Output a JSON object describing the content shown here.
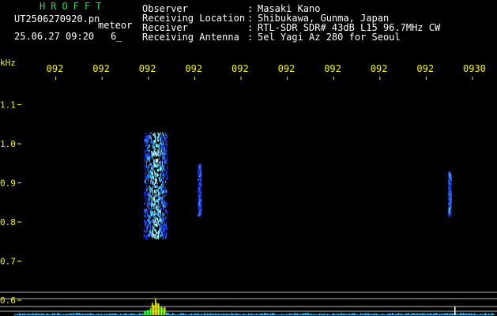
{
  "header": {
    "title": "HROFFT",
    "filename": "UT2506270920.pn",
    "tag": "meteor",
    "datetime": "25.06.27 09:20",
    "count": "6_"
  },
  "info": [
    {
      "label": "Observer",
      "value": "Masaki Kano"
    },
    {
      "label": "Receiving Location",
      "value": "Shibukawa, Gunma, Japan"
    },
    {
      "label": "Receiver",
      "value": "RTL-SDR SDR# 43dB L15 96.7MHz CW"
    },
    {
      "label": "Receiving Antenna",
      "value": "5el Yagi Az 280 for Seoul"
    }
  ],
  "colors": {
    "title": "#22e04a",
    "text": "#ffffff",
    "axis": "#f4f400",
    "background": "#000000"
  },
  "chart_data": {
    "type": "heatmap",
    "ylabel": "kHz",
    "yticks": [
      "1.1",
      "1.0",
      "0.9",
      "0.8",
      "0.7",
      "0.6"
    ],
    "ytick_values": [
      1.1,
      1.0,
      0.9,
      0.8,
      0.7,
      0.6
    ],
    "xticks": [
      "092",
      "092",
      "092",
      "092",
      "092",
      "092",
      "092",
      "092",
      "092",
      "0930"
    ],
    "signals": [
      {
        "minute": 3.15,
        "f_low": 0.76,
        "f_high": 1.03,
        "strength": 1.0
      },
      {
        "minute": 4.1,
        "f_low": 0.82,
        "f_high": 0.95,
        "strength": 0.3
      },
      {
        "minute": 9.5,
        "f_low": 0.82,
        "f_high": 0.93,
        "strength": 0.5
      }
    ]
  }
}
